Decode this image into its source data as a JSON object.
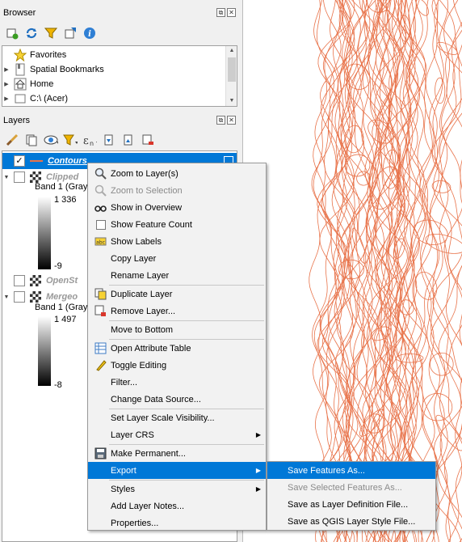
{
  "browser": {
    "title": "Browser",
    "items": [
      {
        "label": "Favorites",
        "icon": "star-icon"
      },
      {
        "label": "Spatial Bookmarks",
        "icon": "bookmarks-icon"
      },
      {
        "label": "Home",
        "icon": "home-icon"
      },
      {
        "label": "C:\\ (Acer)",
        "icon": "drive-icon"
      }
    ]
  },
  "layers": {
    "title": "Layers",
    "items": [
      {
        "label": "Contours",
        "checked": "✓",
        "selected": true
      },
      {
        "label": "Clipped",
        "band": "Band 1 (Gray)",
        "max": "1 336",
        "min": "-9"
      },
      {
        "label": "OpenSt"
      },
      {
        "label": "Mergeo",
        "band": "Band 1 (Gray)",
        "max": "1 497",
        "min": "-8"
      }
    ]
  },
  "context_menu": {
    "items": [
      {
        "label": "Zoom to Layer(s)"
      },
      {
        "label": "Zoom to Selection"
      },
      {
        "label": "Show in Overview"
      },
      {
        "label": "Show Feature Count"
      },
      {
        "label": "Show Labels"
      },
      {
        "label": "Copy Layer"
      },
      {
        "label": "Rename Layer"
      },
      {
        "label": "Duplicate Layer"
      },
      {
        "label": "Remove Layer..."
      },
      {
        "label": "Move to Bottom"
      },
      {
        "label": "Open Attribute Table"
      },
      {
        "label": "Toggle Editing"
      },
      {
        "label": "Filter..."
      },
      {
        "label": "Change Data Source..."
      },
      {
        "label": "Set Layer Scale Visibility..."
      },
      {
        "label": "Layer CRS"
      },
      {
        "label": "Make Permanent..."
      },
      {
        "label": "Export"
      },
      {
        "label": "Styles"
      },
      {
        "label": "Add Layer Notes..."
      },
      {
        "label": "Properties..."
      }
    ]
  },
  "export_submenu": {
    "items": [
      {
        "label": "Save Features As..."
      },
      {
        "label": "Save Selected Features As..."
      },
      {
        "label": "Save as Layer Definition File..."
      },
      {
        "label": "Save as QGIS Layer Style File..."
      }
    ]
  },
  "colors": {
    "accent": "#0078d7",
    "contour": "#e8734a"
  }
}
